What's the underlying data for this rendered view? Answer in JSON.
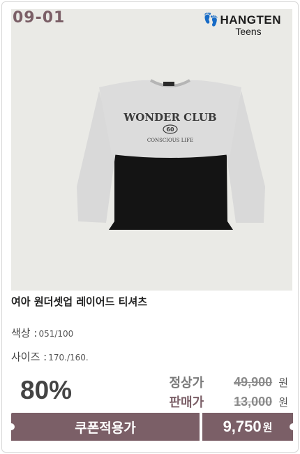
{
  "product": {
    "code": "09-01",
    "brand": "HANGTEN",
    "brand_sub": "Teens",
    "print_line1": "WONDER CLUB",
    "print_num": "60",
    "print_line2": "CONSCIOUS LIFE",
    "title": "여아 원더셋업 레이어드 티셔츠",
    "color_label": "색상 :",
    "color_value": "051/100",
    "size_label": "사이즈 :",
    "size_value": "170./160."
  },
  "pricing": {
    "discount": "80%",
    "regular_label": "정상가",
    "regular_price": "49,900",
    "sale_label": "판매가",
    "sale_price": "13,000",
    "currency": "원",
    "coupon_label": "쿠폰적용가",
    "final_price": "9,750",
    "final_currency": "원"
  },
  "colors": {
    "accent": "#7b5f67",
    "photo_bg": "#eaeae6"
  }
}
